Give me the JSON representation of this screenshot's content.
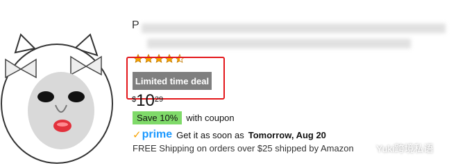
{
  "product": {
    "title_partial": "P",
    "rating_stars": 4.5,
    "deal_label": "Limited time deal",
    "price": {
      "currency": "$",
      "whole": "10",
      "fraction": "29"
    },
    "coupon": {
      "badge": "Save 10%",
      "text": "with coupon"
    },
    "prime": {
      "logo": "prime",
      "delivery_prefix": "Get it as soon as",
      "delivery_date": "Tomorrow, Aug 20"
    },
    "shipping": "FREE Shipping on orders over $25 shipped by Amazon"
  },
  "watermark": {
    "text": "Yuki跨境私语"
  },
  "colors": {
    "deal_badge": "#7f7f7f",
    "coupon_badge": "#7fda69",
    "highlight_box": "#e3161a",
    "prime_blue": "#1a98ff",
    "star": "#f7a200"
  },
  "icons": {
    "rating": "star-icon",
    "prime": "prime-check-icon",
    "watermark": "wechat-icon"
  }
}
